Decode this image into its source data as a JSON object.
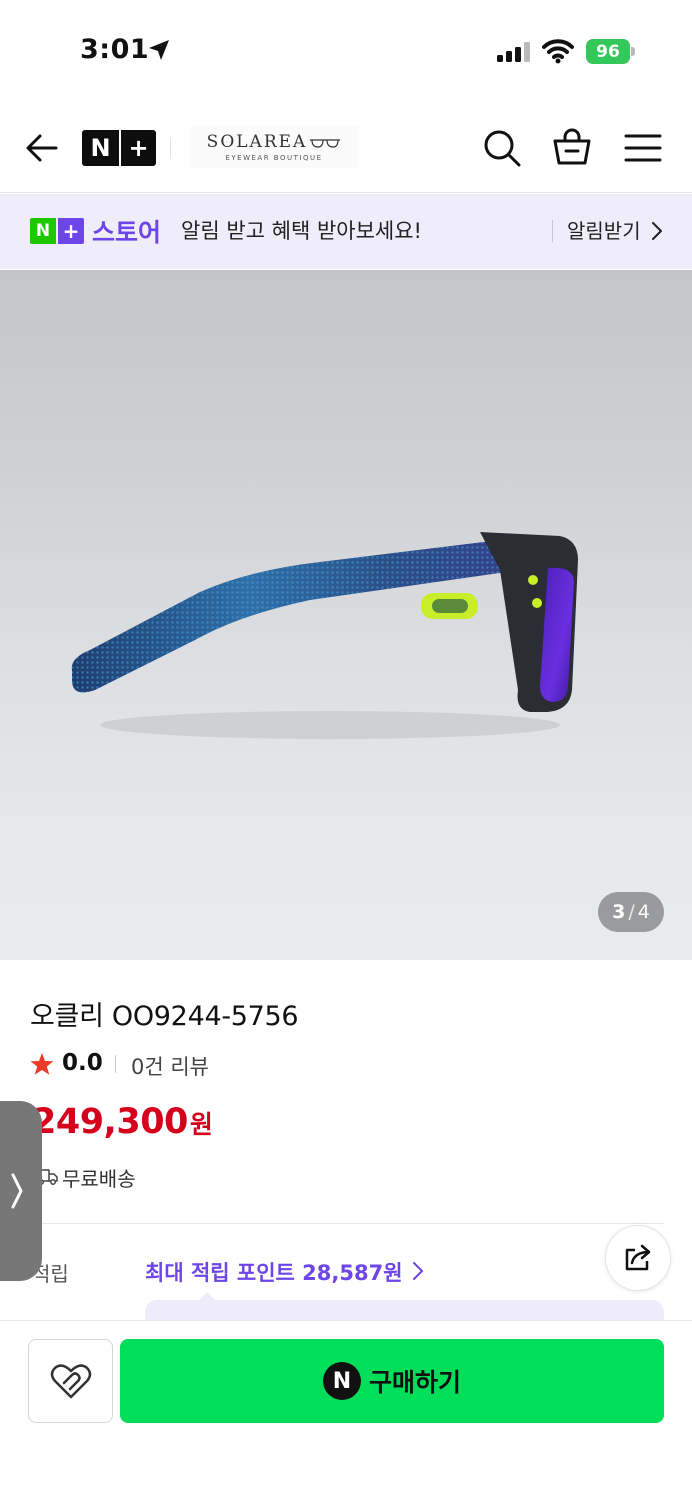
{
  "status_bar": {
    "time": "3:01",
    "battery": "96"
  },
  "header": {
    "logo_n": "N",
    "logo_plus": "+",
    "store_name": "SOLAREA",
    "store_subtitle": "EYEWEAR BOUTIQUE"
  },
  "banner": {
    "logo_n": "N",
    "logo_plus": "+",
    "store_label": "스토어",
    "message": "알림 받고 혜택 받아보세요!",
    "action": "알림받기"
  },
  "gallery": {
    "current": "3",
    "separator": "/",
    "total": "4"
  },
  "product": {
    "title": "오클리 OO9244-5756",
    "rating": "0.0",
    "review_count": "0건 리뷰",
    "price": "249,300",
    "price_unit": "원",
    "shipping": "무료배송",
    "points_label": "적립",
    "points_value": "최대 적립 포인트 28,587원"
  },
  "bottom_bar": {
    "npay_symbol": "N",
    "buy_label": "구매하기"
  },
  "colors": {
    "accent_purple": "#6e45e8",
    "price_red": "#d5001c",
    "buy_green": "#00de5a",
    "naver_green": "#1ec800",
    "star": "#ec3b2a"
  },
  "icons": [
    "back-arrow-icon",
    "search-icon",
    "cart-icon",
    "menu-icon",
    "location-arrow-icon",
    "signal-icon",
    "wifi-icon",
    "star-icon",
    "truck-icon",
    "share-icon",
    "heart-icon",
    "chevron-right-icon"
  ]
}
